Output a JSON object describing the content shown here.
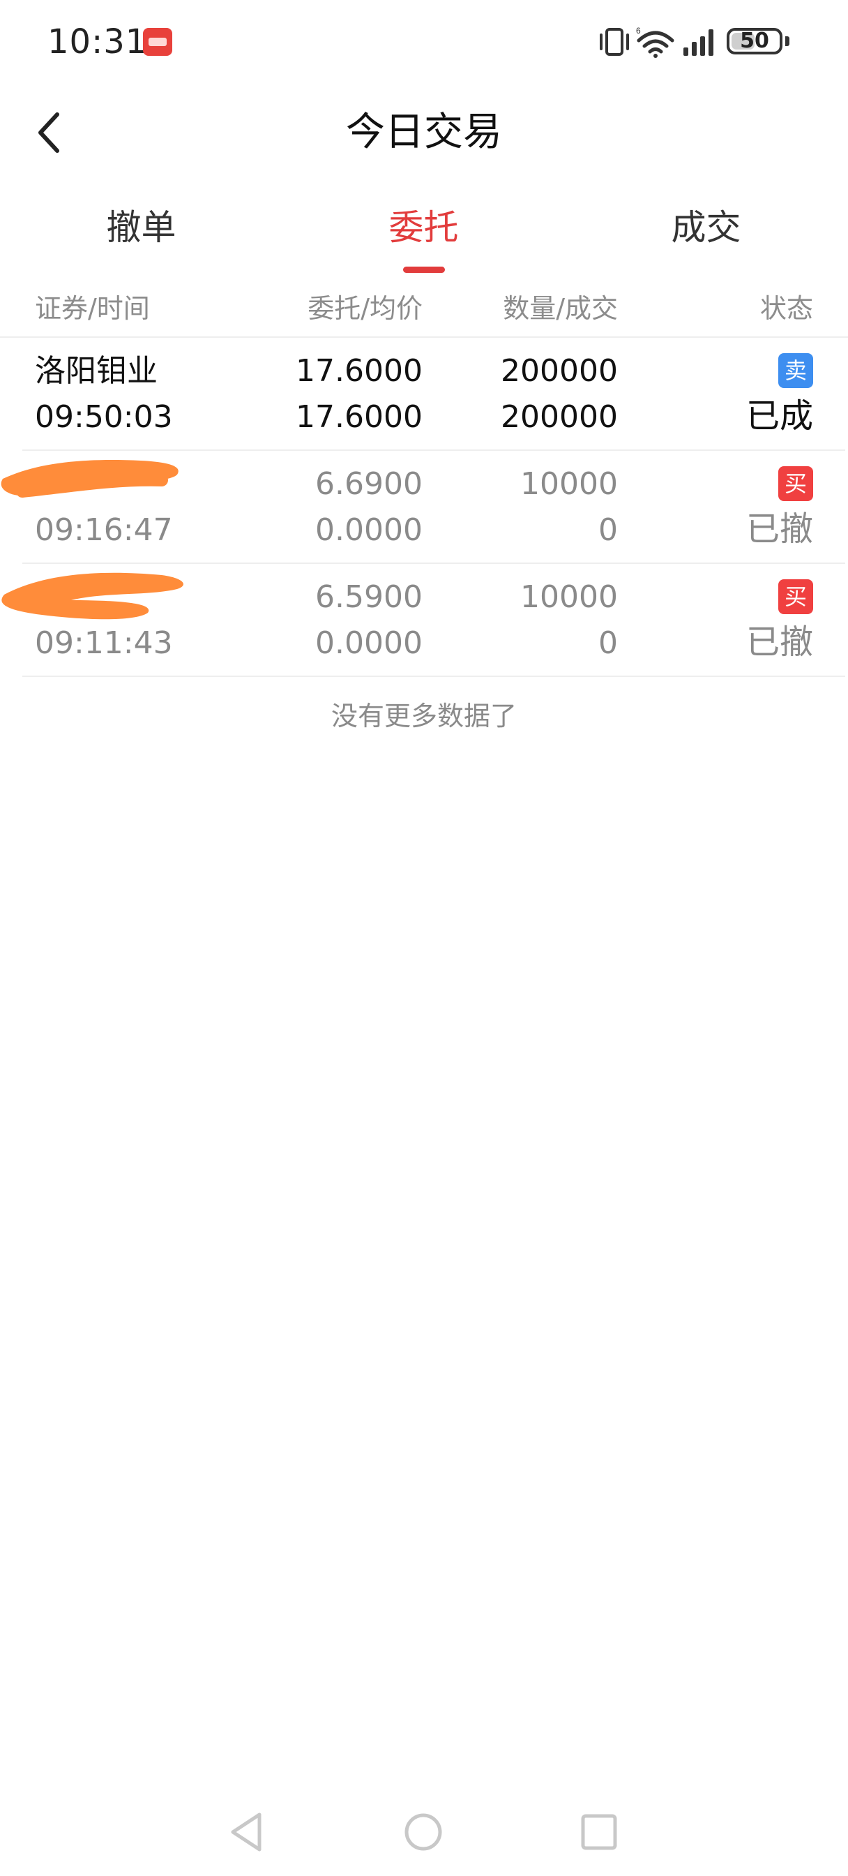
{
  "status_bar": {
    "time": "10:31",
    "battery": "50",
    "battery_level": 0.5,
    "network_label": "6"
  },
  "header": {
    "title": "今日交易"
  },
  "tabs": [
    {
      "label": "撤单",
      "active": false
    },
    {
      "label": "委托",
      "active": true
    },
    {
      "label": "成交",
      "active": false
    }
  ],
  "table": {
    "columns": [
      "证券/时间",
      "委托/均价",
      "数量/成交",
      "状态"
    ],
    "rows": [
      {
        "name": "洛阳钼业",
        "time": "09:50:03",
        "order_price": "17.6000",
        "avg_price": "17.6000",
        "quantity": "200000",
        "filled": "200000",
        "side": "卖",
        "status": "已成"
      },
      {
        "name": "",
        "time": "09:16:47",
        "order_price": "6.6900",
        "avg_price": "0.0000",
        "quantity": "10000",
        "filled": "0",
        "side": "买",
        "status": "已撤"
      },
      {
        "name": "",
        "time": "09:11:43",
        "order_price": "6.5900",
        "avg_price": "0.0000",
        "quantity": "10000",
        "filled": "0",
        "side": "买",
        "status": "已撤"
      }
    ]
  },
  "footer": {
    "no_more_text": "没有更多数据了"
  },
  "colors": {
    "accent": "#e23c3c",
    "sell_badge": "#3d8ef0",
    "buy_badge": "#f04040",
    "redaction": "#ff8c3a"
  },
  "icons": {
    "back": "chevron-left-icon",
    "nav_back": "triangle-back-icon",
    "nav_home": "circle-home-icon",
    "nav_recent": "square-recent-icon"
  }
}
